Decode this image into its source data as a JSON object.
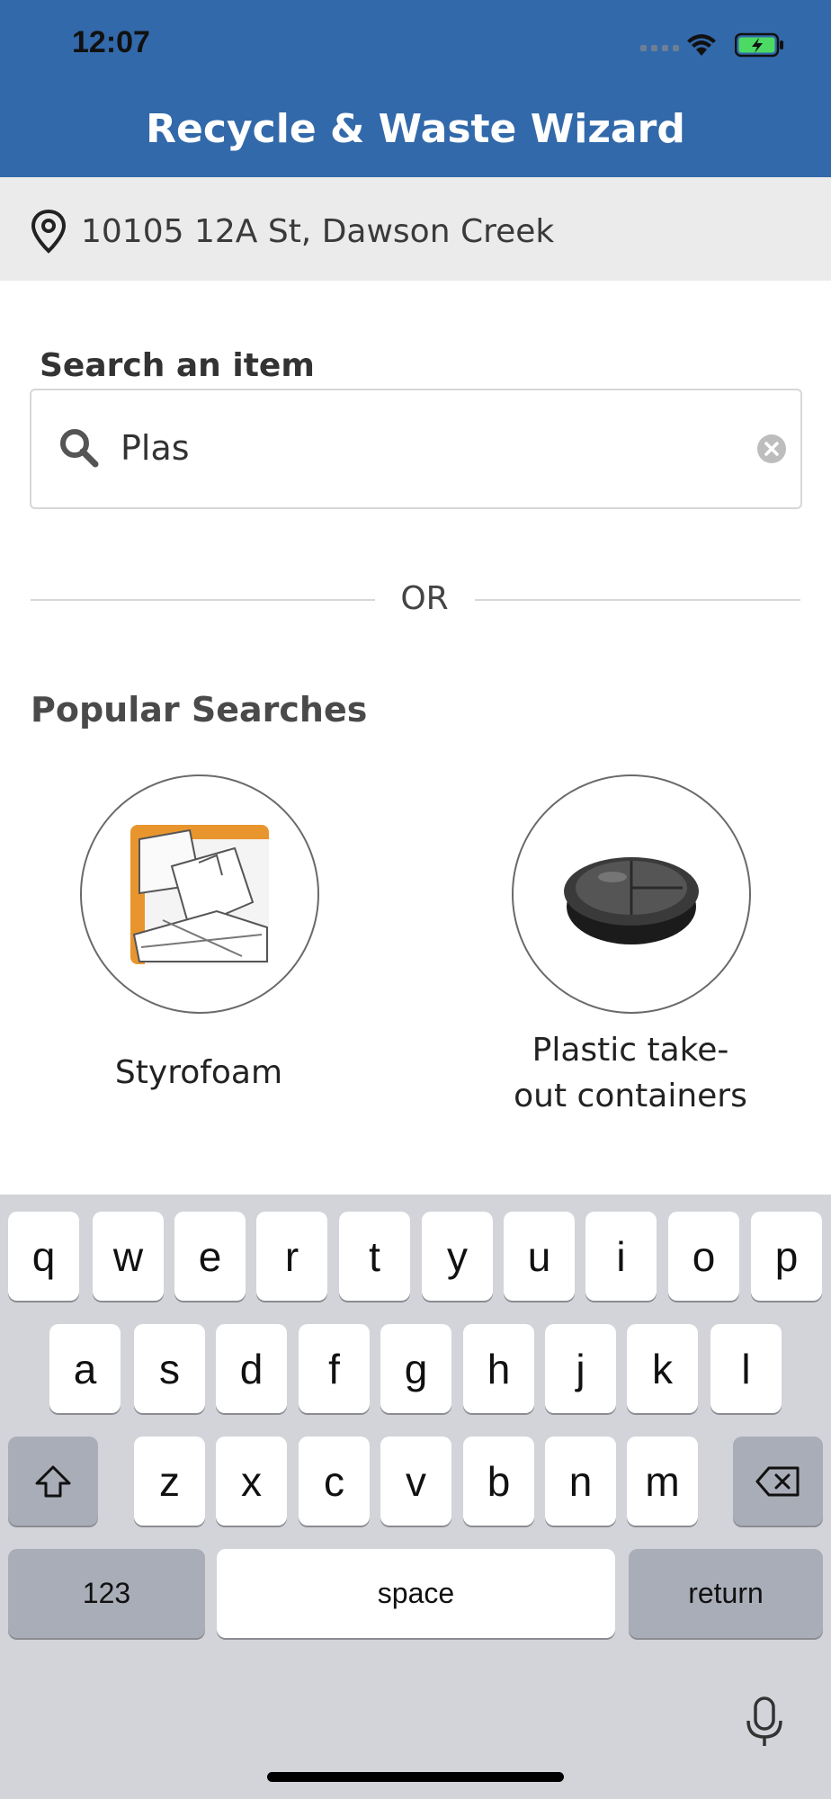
{
  "status_bar": {
    "time": "12:07",
    "signal_icon": "signal-icon",
    "wifi_icon": "wifi-icon",
    "battery_icon": "battery-charging-icon"
  },
  "header": {
    "title": "Recycle & Waste Wizard",
    "color": "#3269aa"
  },
  "address": {
    "icon": "location-pin-icon",
    "text": "10105 12A St, Dawson Creek"
  },
  "search": {
    "label": "Search an item",
    "value": "Plas",
    "search_icon": "search-icon",
    "clear_icon": "clear-icon"
  },
  "divider": {
    "text": "OR"
  },
  "popular": {
    "title": "Popular Searches",
    "items": [
      {
        "label": "Styrofoam",
        "image": "styrofoam-image"
      },
      {
        "label_line1": "Plastic take-",
        "label_line2": "out containers",
        "image": "takeout-container-image"
      }
    ]
  },
  "keyboard": {
    "row1": [
      "q",
      "w",
      "e",
      "r",
      "t",
      "y",
      "u",
      "i",
      "o",
      "p"
    ],
    "row2": [
      "a",
      "s",
      "d",
      "f",
      "g",
      "h",
      "j",
      "k",
      "l"
    ],
    "row3": [
      "z",
      "x",
      "c",
      "v",
      "b",
      "n",
      "m"
    ],
    "numbers": "123",
    "space": "space",
    "return": "return",
    "shift_icon": "shift-icon",
    "backspace_icon": "backspace-icon",
    "mic_icon": "microphone-icon"
  }
}
